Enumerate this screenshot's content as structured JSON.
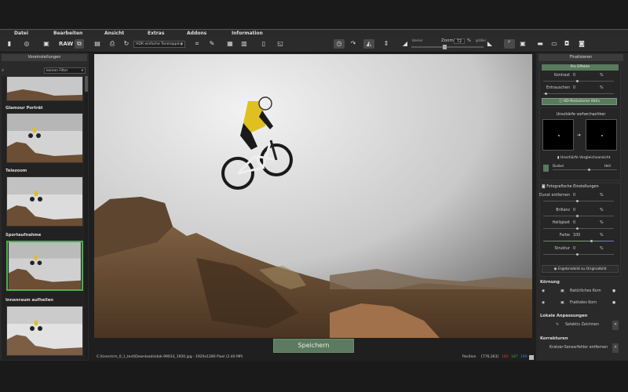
{
  "menu": [
    "Datei",
    "Bearbeiten",
    "Ansicht",
    "Extras",
    "Addons",
    "Information"
  ],
  "toolbar": {
    "raw_label": "RAW",
    "preset_select": "HDR einfache Tonmapping",
    "zoom_label": "Zoom",
    "zoom_value": "72",
    "zoom_unit": "%",
    "zoom_smaller": "kleiner",
    "zoom_larger": "größer"
  },
  "left": {
    "header": "Voreinstellungen",
    "filter": "keinen Filter",
    "presets": [
      "Glamour Porträt",
      "Telezoom",
      "Sportaufnahme",
      "Innenraum aufhellen"
    ]
  },
  "center": {
    "save_label": "Speichern",
    "status_path": "C:\\Users\\rm_0_1_test\\Downloads\\dak-99033_1920.jpg - 1920x1280 Pixel (2.40 MP)",
    "status_pos_label": "Position",
    "status_coords": "[776,363]",
    "status_r": "185",
    "status_g": "187",
    "status_b": "189",
    "colors": {
      "r": "#e53935",
      "g": "#43a047",
      "b": "#1e88e5"
    }
  },
  "right": {
    "header": "Finalisieren",
    "pro_label": "Pro Effekte",
    "sliders1": [
      {
        "label": "Kontrast",
        "value": "0",
        "unit": "%"
      },
      {
        "label": "Entrauschen",
        "value": "0",
        "unit": "%"
      }
    ],
    "hdr_button": "HD-Reduzieren Aktiv",
    "blur_label": "Unschärfe vorher/nachher",
    "blur_compare": "Unschärfe Vergleichsansicht",
    "dark_label": "Dunkel",
    "bright_label": "Hell",
    "photo_settings": "Fotografische Einstellungen",
    "sliders2": [
      {
        "label": "Dunst entfernen",
        "value": "0",
        "unit": "%"
      },
      {
        "label": "Brillanz",
        "value": "0",
        "unit": "%"
      },
      {
        "label": "Helligkeit",
        "value": "0",
        "unit": "%"
      },
      {
        "label": "Farbe",
        "value": "100",
        "unit": "%"
      },
      {
        "label": "Struktur",
        "value": "0",
        "unit": "%"
      }
    ],
    "compare_btn": "Ergebnisbild zu Originalbild",
    "kuemung_title": "Körnung",
    "natural_grain": "Natürliches Korn",
    "fractal_grain": "Fraktales Korn",
    "local_title": "Lokale Anpassungen",
    "select_draw": "Selektiv Zeichnen",
    "corrections_title": "Korrekturen",
    "remove_sensor": "Kratzer-Sensorfehler entfernen"
  }
}
